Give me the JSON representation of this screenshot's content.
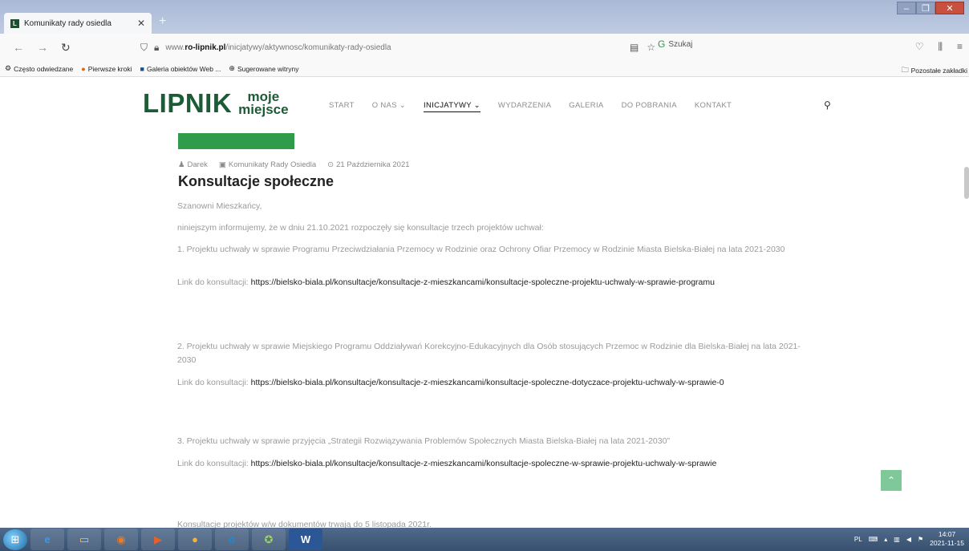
{
  "browser": {
    "tab_title": "Komunikaty rady osiedla",
    "tab_favicon": "L",
    "url_prefix": "www.",
    "url_host": "ro-lipnik.pl",
    "url_path": "/inicjatywy/aktywnosc/komunikaty-rady-osiedla",
    "search_label": "Szukaj",
    "bookmarks": [
      "Często odwiedzane",
      "Pierwsze kroki",
      "Galeria obiektów Web ...",
      "Sugerowane witryny"
    ],
    "other_bookmarks": "Pozostałe zakładki"
  },
  "site": {
    "logo_main": "LIPNIK",
    "logo_sub_1": "moje",
    "logo_sub_2": "miejsce",
    "menu": [
      "START",
      "O NAS",
      "INICJATYWY",
      "WYDARZENIA",
      "GALERIA",
      "DO POBRANIA",
      "KONTAKT"
    ]
  },
  "post": {
    "author": "Darek",
    "category": "Komunikaty Rady Osiedla",
    "date": "21 Października 2021",
    "title": "Konsultacje społeczne",
    "greeting": "Szanowni Mieszkańcy,",
    "intro": "niniejszym informujemy, że w dniu 21.10.2021 rozpoczęły się konsultacje trzech projektów uchwał:",
    "item1": "1. Projektu uchwały w sprawie Programu Przeciwdziałania Przemocy w Rodzinie oraz Ochrony Ofiar Przemocy w Rodzinie Miasta Bielska-Białej na lata 2021-2030",
    "link_label": "Link do konsultacji:",
    "link1": "https://bielsko-biala.pl/konsultacje/konsultacje-z-mieszkancami/konsultacje-spoleczne-projektu-uchwaly-w-sprawie-programu",
    "item2": "2. Projektu uchwały w sprawie Miejskiego Programu Oddziaływań Korekcyjno-Edukacyjnych dla Osób stosujących Przemoc w Rodzinie dla Bielska-Białej na lata 2021-2030",
    "link2": "https://bielsko-biala.pl/konsultacje/konsultacje-z-mieszkancami/konsultacje-spoleczne-dotyczace-projektu-uchwaly-w-sprawie-0",
    "item3": "3. Projektu uchwały w sprawie przyjęcia „Strategii Rozwiązywania Problemów Społecznych Miasta Bielska-Białej na lata 2021-2030”",
    "link3": "https://bielsko-biala.pl/konsultacje/konsultacje-z-mieszkancami/konsultacje-spoleczne-w-sprawie-projektu-uchwaly-w-sprawie",
    "closing": "Konsultacje projektów w/w dokumentów trwają do 5 listopada 2021r."
  },
  "taskbar": {
    "lang": "PL",
    "time": "14:07",
    "date": "2021-11-15",
    "word_label": "W"
  }
}
